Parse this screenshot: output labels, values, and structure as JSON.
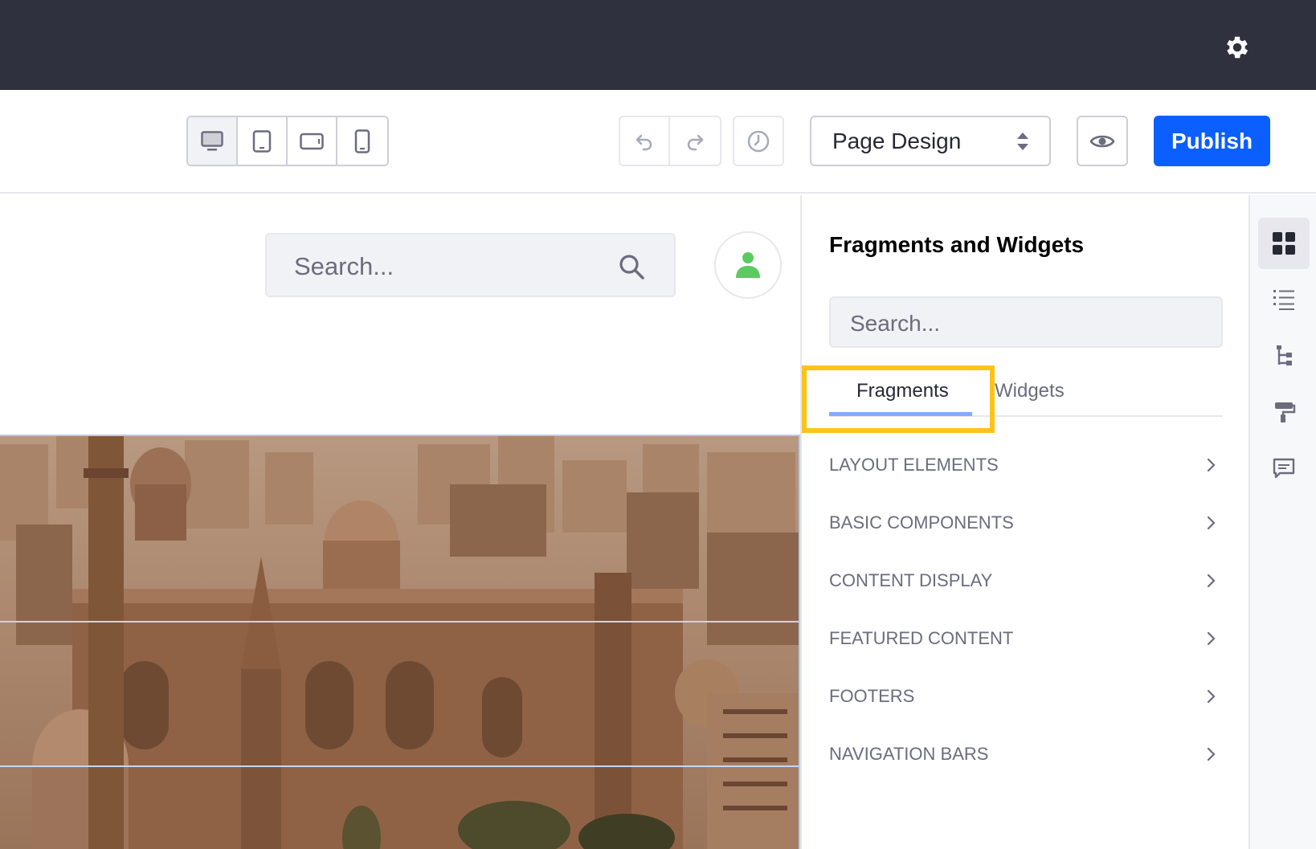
{
  "topbar": {
    "settings_icon": "gear-icon"
  },
  "toolbar": {
    "devices": [
      {
        "name": "desktop",
        "icon": "desktop-icon",
        "active": true
      },
      {
        "name": "tablet",
        "icon": "tablet-icon",
        "active": false
      },
      {
        "name": "landscape-phone",
        "icon": "landscape-phone-icon",
        "active": false
      },
      {
        "name": "portrait-phone",
        "icon": "portrait-phone-icon",
        "active": false
      }
    ],
    "undo_icon": "undo-icon",
    "redo_icon": "redo-icon",
    "history_icon": "clock-icon",
    "experience_select": "Page Design",
    "preview_icon": "eye-icon",
    "publish_label": "Publish"
  },
  "canvas": {
    "search_placeholder": "Search...",
    "user_icon": "user-icon"
  },
  "panel": {
    "title": "Fragments and Widgets",
    "search_placeholder": "Search...",
    "tabs": [
      {
        "label": "Fragments",
        "active": true
      },
      {
        "label": "Widgets",
        "active": false
      }
    ],
    "categories": [
      {
        "label": "LAYOUT ELEMENTS"
      },
      {
        "label": "BASIC COMPONENTS"
      },
      {
        "label": "CONTENT DISPLAY"
      },
      {
        "label": "FEATURED CONTENT"
      },
      {
        "label": "FOOTERS"
      },
      {
        "label": "NAVIGATION BARS"
      }
    ]
  },
  "rail": {
    "items": [
      "grid-icon",
      "list-icon",
      "tree-icon",
      "paint-roller-icon",
      "comment-icon"
    ]
  },
  "colors": {
    "topbar": "#30313f",
    "primary": "#0b5fff",
    "highlight": "#fcc419",
    "tab_underline": "#80acff"
  }
}
